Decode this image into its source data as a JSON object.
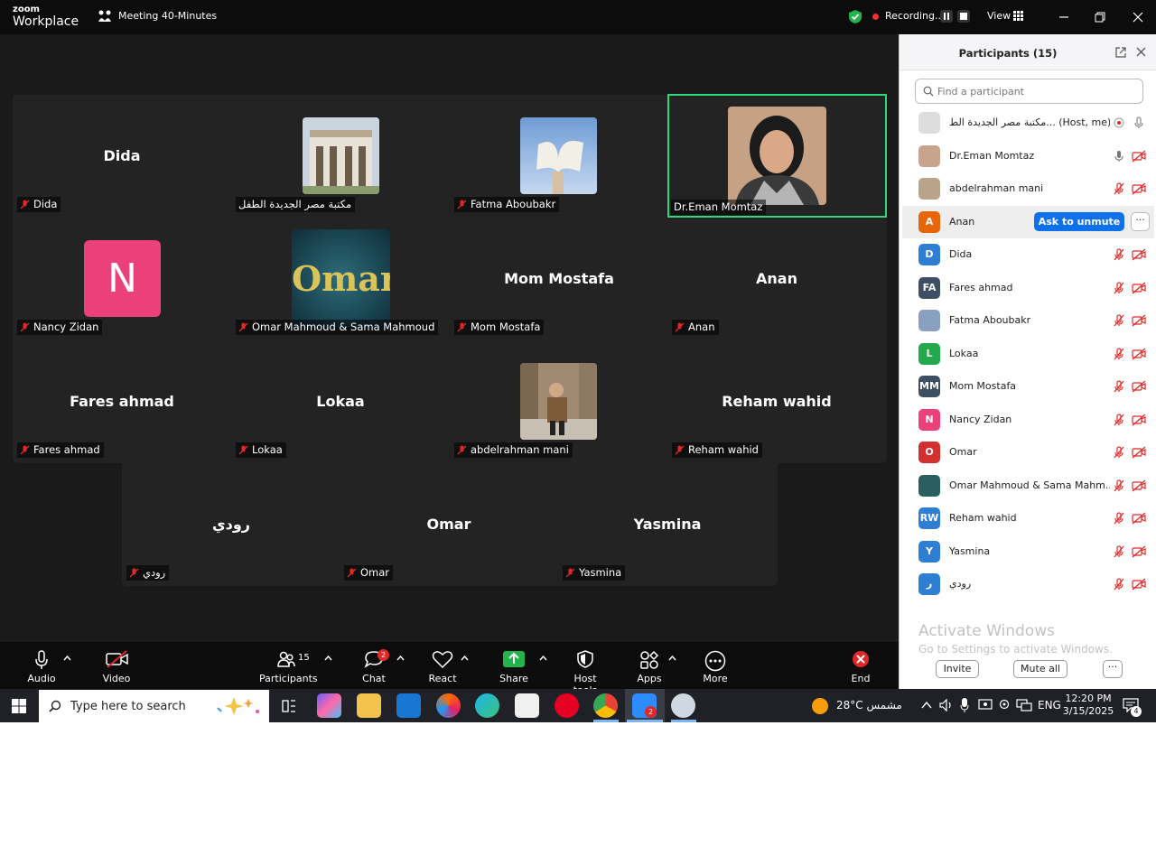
{
  "titlebar": {
    "brand_top": "zoom",
    "brand_bottom": "Workplace",
    "meeting_title": "Meeting 40-Minutes",
    "recording_label": "Recording...",
    "view_label": "View"
  },
  "tiles": [
    {
      "display": "Dida",
      "label": "Dida"
    },
    {
      "display": "",
      "label": "مكتبة مصر الجديدة الطفل"
    },
    {
      "display": "",
      "label": "Fatma Aboubakr"
    },
    {
      "display": "",
      "label": "Dr.Eman Momtaz"
    },
    {
      "display": "N",
      "label": "Nancy Zidan"
    },
    {
      "display": "Omar",
      "label": "Omar Mahmoud & Sama Mahmoud"
    },
    {
      "display": "Mom Mostafa",
      "label": "Mom Mostafa"
    },
    {
      "display": "Anan",
      "label": "Anan"
    },
    {
      "display": "Fares ahmad",
      "label": "Fares ahmad"
    },
    {
      "display": "Lokaa",
      "label": "Lokaa"
    },
    {
      "display": "",
      "label": "abdelrahman mani"
    },
    {
      "display": "Reham wahid",
      "label": "Reham wahid"
    },
    {
      "display": "رودي",
      "label": "رودي"
    },
    {
      "display": "Omar",
      "label": "Omar"
    },
    {
      "display": "Yasmina",
      "label": "Yasmina"
    }
  ],
  "participants": {
    "title": "Participants (15)",
    "search_placeholder": "Find a participant",
    "ask_to_unmute": "Ask to unmute",
    "more": "···",
    "list": [
      {
        "initials": "",
        "name": "مكتبة مصر الجديدة الط... (Host, me)",
        "color": "#ddd"
      },
      {
        "initials": "",
        "name": "Dr.Eman Momtaz",
        "color": "#c9a48d"
      },
      {
        "initials": "",
        "name": "abdelrahman mani",
        "color": "#b9a48a"
      },
      {
        "initials": "A",
        "name": "Anan",
        "color": "#e8660a"
      },
      {
        "initials": "D",
        "name": "Dida",
        "color": "#2e7fd3"
      },
      {
        "initials": "FA",
        "name": "Fares ahmad",
        "color": "#3f4f63"
      },
      {
        "initials": "",
        "name": "Fatma Aboubakr",
        "color": "#8aa0c0"
      },
      {
        "initials": "L",
        "name": "Lokaa",
        "color": "#22a94b"
      },
      {
        "initials": "MM",
        "name": "Mom Mostafa",
        "color": "#3f4f63"
      },
      {
        "initials": "N",
        "name": "Nancy Zidan",
        "color": "#ec407a"
      },
      {
        "initials": "O",
        "name": "Omar",
        "color": "#d32f2f"
      },
      {
        "initials": "",
        "name": "Omar Mahmoud & Sama Mahm...",
        "color": "#2b5e5e"
      },
      {
        "initials": "RW",
        "name": "Reham wahid",
        "color": "#2e7fd3"
      },
      {
        "initials": "Y",
        "name": "Yasmina",
        "color": "#2e7fd3"
      },
      {
        "initials": "ر",
        "name": "رودي",
        "color": "#2e7fd3"
      }
    ],
    "activate_title": "Activate Windows",
    "activate_sub": "Go to Settings to activate Windows.",
    "invite": "Invite",
    "mute_all": "Mute all"
  },
  "toolbar": {
    "audio": "Audio",
    "video": "Video",
    "participants": "Participants",
    "participants_count": "15",
    "chat": "Chat",
    "chat_badge": "2",
    "react": "React",
    "share": "Share",
    "host_tools": "Host tools",
    "apps": "Apps",
    "more": "More",
    "end": "End"
  },
  "taskbar": {
    "search_placeholder": "Type here to search",
    "zoom_badge": "2",
    "weather": "28°C  مشمس",
    "lang": "ENG",
    "time": "12:20 PM",
    "date": "3/15/2025",
    "notif_count": "4"
  },
  "colors": {
    "accent": "#0e71eb",
    "active_speaker": "#2fd67b",
    "mute_red": "#e02828",
    "share_green": "#24b24b"
  }
}
